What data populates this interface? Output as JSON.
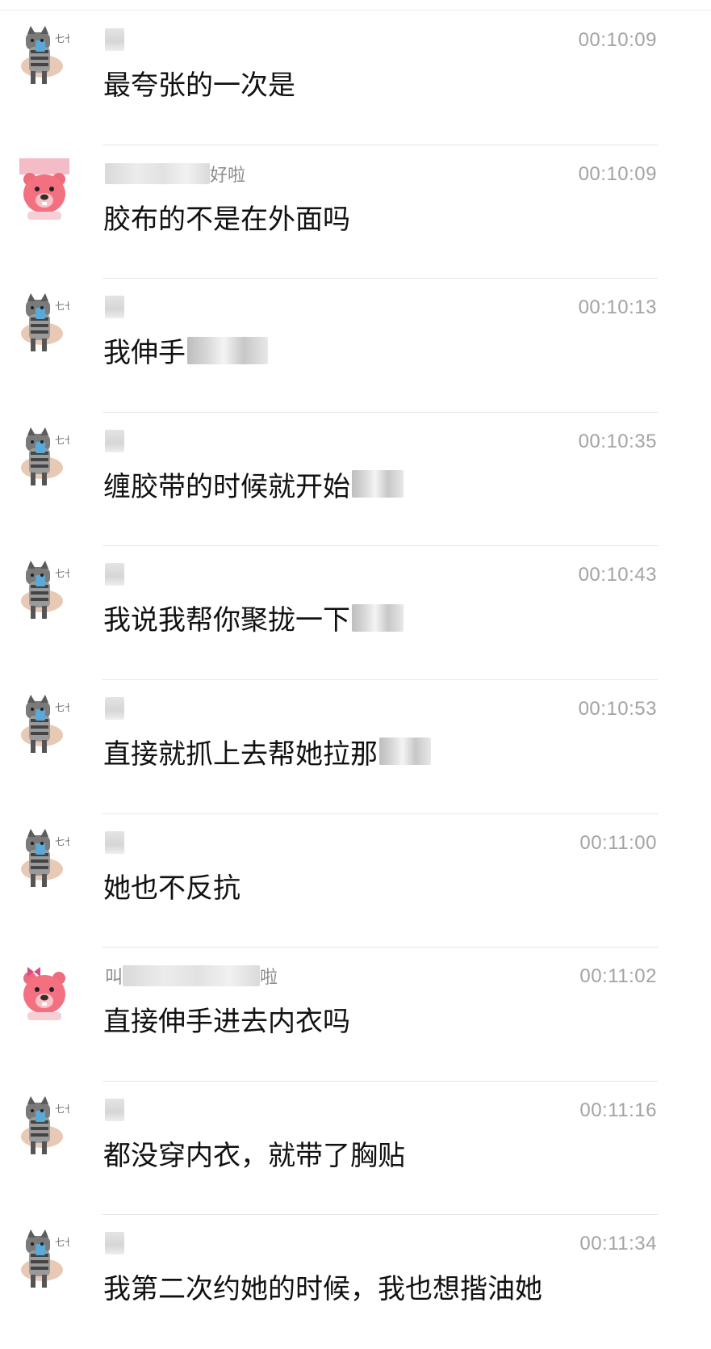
{
  "colors": {
    "background": "#ffffff",
    "message_text": "#111111",
    "name_text": "#8c8c8c",
    "time_text": "#a3a3a3",
    "divider": "#e6e6e6"
  },
  "messages": [
    {
      "avatar": "cat-avatar-icon",
      "sender_prefix": "",
      "sender_suffix": "",
      "time": "00:10:09",
      "text": "最夸张的一次是",
      "redacted_tail": false
    },
    {
      "avatar": "pink-bear-avatar-icon",
      "sender_prefix": "",
      "sender_suffix": "好啦",
      "time": "00:10:09",
      "text": "胶布的不是在外面吗",
      "redacted_tail": false
    },
    {
      "avatar": "cat-avatar-icon",
      "sender_prefix": "",
      "sender_suffix": "",
      "time": "00:10:13",
      "text": "我伸手",
      "redacted_tail": true
    },
    {
      "avatar": "cat-avatar-icon",
      "sender_prefix": "",
      "sender_suffix": "",
      "time": "00:10:35",
      "text": "缠胶带的时候就开始",
      "redacted_tail": true
    },
    {
      "avatar": "cat-avatar-icon",
      "sender_prefix": "",
      "sender_suffix": "",
      "time": "00:10:43",
      "text": "我说我帮你聚拢一下",
      "redacted_tail": true
    },
    {
      "avatar": "cat-avatar-icon",
      "sender_prefix": "",
      "sender_suffix": "",
      "time": "00:10:53",
      "text": "直接就抓上去帮她拉那",
      "redacted_tail": true
    },
    {
      "avatar": "cat-avatar-icon",
      "sender_prefix": "",
      "sender_suffix": "",
      "time": "00:11:00",
      "text": "她也不反抗",
      "redacted_tail": false
    },
    {
      "avatar": "pink-bear-avatar-icon",
      "sender_prefix": "叫",
      "sender_suffix": "啦",
      "time": "00:11:02",
      "text": "直接伸手进去内衣吗",
      "redacted_tail": false
    },
    {
      "avatar": "cat-avatar-icon",
      "sender_prefix": "",
      "sender_suffix": "",
      "time": "00:11:16",
      "text": "都没穿内衣，就带了胸贴",
      "redacted_tail": false
    },
    {
      "avatar": "cat-avatar-icon",
      "sender_prefix": "",
      "sender_suffix": "",
      "time": "00:11:34",
      "text": "我第二次约她的时候，我也想揩油她",
      "redacted_tail": false
    }
  ]
}
